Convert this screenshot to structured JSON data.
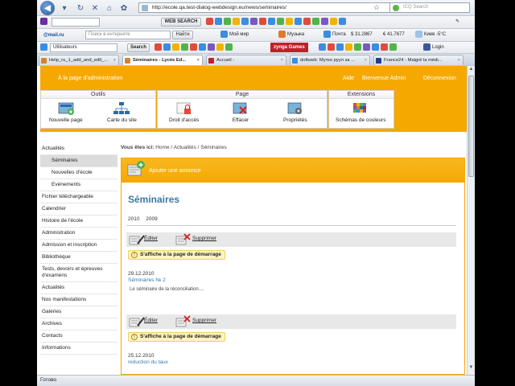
{
  "browser": {
    "url": "http://ecole.qa.test-dialog-webdesign.eu/news/seminaires/",
    "search_placeholder": "ICQ Search",
    "status": "Готово"
  },
  "toolbar1": {
    "web_search_label": "WEB SEARCH"
  },
  "toolbar2": {
    "mail_label": "@mail.ru",
    "search_placeholder": "Поиск в интернете",
    "find_label": "Найти",
    "moi_mir": "Мой мир",
    "music": "Музыка",
    "mail": "Почта",
    "usd": "31.2867",
    "eur": "41.7677",
    "weather": "Киев -5°C"
  },
  "toolbar3": {
    "users_label": "Utilisateurs",
    "search_button": "Search",
    "zynga": "zynga Games",
    "login": "Login"
  },
  "tabs": [
    {
      "label": "Help_ru_1_add_and_edit_..."
    },
    {
      "label": "Séminaires - Lycée Ed..."
    },
    {
      "label": "Accueil -"
    },
    {
      "label": "dolboeb: Мутко руул за ..."
    },
    {
      "label": "France24 - Maigré la médi..."
    }
  ],
  "header": {
    "admin_link": "À la page d'administration",
    "aide": "Aide",
    "welcome": "Bienvenue Admin",
    "logout": "Déconnexion"
  },
  "panels": {
    "outils": {
      "title": "Outils",
      "items": [
        "Nouvelle page",
        "Carte du site"
      ]
    },
    "page": {
      "title": "Page",
      "items": [
        "Droit d'accès",
        "Effacer",
        "Propriétés"
      ]
    },
    "extensions": {
      "title": "Extensions",
      "items": [
        "Schémas de couleurs"
      ]
    }
  },
  "sidebar": {
    "items": [
      {
        "label": "Actualités"
      },
      {
        "label": "Séminaires"
      },
      {
        "label": "Nouvelles d'école"
      },
      {
        "label": "Evénements"
      },
      {
        "label": "Fichier téléchargeable"
      },
      {
        "label": "Calendrier"
      },
      {
        "label": "Histoire de l'école"
      },
      {
        "label": "Administration"
      },
      {
        "label": "Admission et inscription"
      },
      {
        "label": "Bibliothèque"
      },
      {
        "label": "Tests, devoirs et épreuves d'examens"
      },
      {
        "label": "Actualités"
      },
      {
        "label": "Nos manifestations"
      },
      {
        "label": "Galeries"
      },
      {
        "label": "Archives"
      },
      {
        "label": "Contacts"
      },
      {
        "label": "Informations"
      }
    ]
  },
  "breadcrumb": {
    "prefix": "Vous êtes ici:",
    "path": "Home / Actualités / Séminaires"
  },
  "main": {
    "add_announcement": "Ajouter une annonce",
    "title": "Séminaires",
    "years": [
      "2010",
      "2009"
    ],
    "edit_label": "Éditer",
    "delete_label": "Supprimer",
    "notice": "S'affiche à la page de démarrage",
    "posts": [
      {
        "date": "29.12.2010",
        "title": "Séminaires № 2",
        "text": "Le séminaire de la réconciliation...."
      },
      {
        "date": "25.12.2010",
        "title": "reduction du taux",
        "text": ""
      }
    ]
  }
}
